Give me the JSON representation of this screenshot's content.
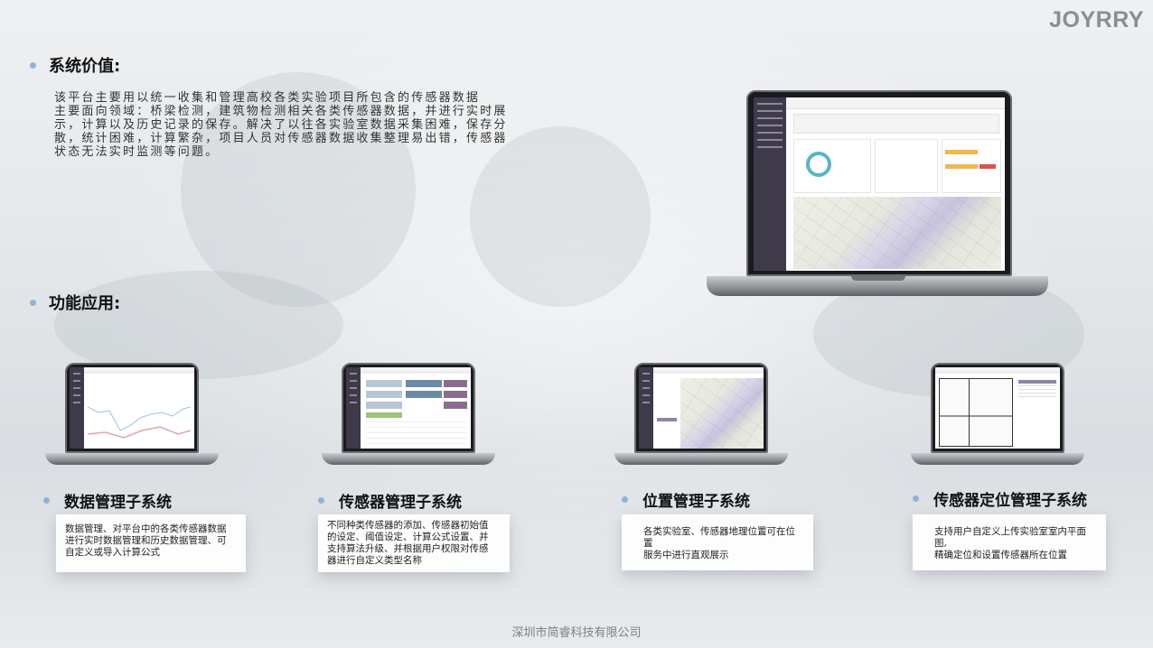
{
  "brand": "JOYRRY",
  "section1": {
    "title": "系统价值:"
  },
  "intro_lines": [
    "该平台主要用以统一收集和管理高校各类实验项目所包含的传感器数据",
    "主要面向领域：桥梁检测，建筑物检测相关各类传感器数据，并进行实时展",
    "示，计算以及历史记录的保存。解决了以往各实验室数据采集困难，保存分",
    "散，统计困难，计算繁杂，项目人员对传感器数据收集整理易出错，传感器",
    "状态无法实时监测等问题。"
  ],
  "section2": {
    "title": "功能应用:"
  },
  "modules": [
    {
      "title": "数据管理子系统",
      "desc": [
        "数据管理、对平台中的各类传感器数据",
        "进行实时数据管理和历史数据管理、可",
        "自定义或导入计算公式"
      ]
    },
    {
      "title": "传感器管理子系统",
      "desc": [
        "不同种类传感器的添加、传感器初始值",
        "的设定、阈值设定、计算公式设置、并",
        "支持算法升级、并根据用户权限对传感",
        "器进行自定义类型名称"
      ]
    },
    {
      "title": "位置管理子系统",
      "desc": [
        "各类实验室、传感器地理位置可在位置",
        "服务中进行直观展示"
      ]
    },
    {
      "title": "传感器定位管理子系统",
      "desc": [
        "支持用户自定义上传实验室室内平面图,",
        "精确定位和设置传感器所在位置"
      ]
    }
  ],
  "footer": "深圳市简睿科技有限公司",
  "colors": {
    "accent_dot": "#8fb3d8",
    "sidebar": "#3f3a4a",
    "brand": "#8a8d91"
  }
}
